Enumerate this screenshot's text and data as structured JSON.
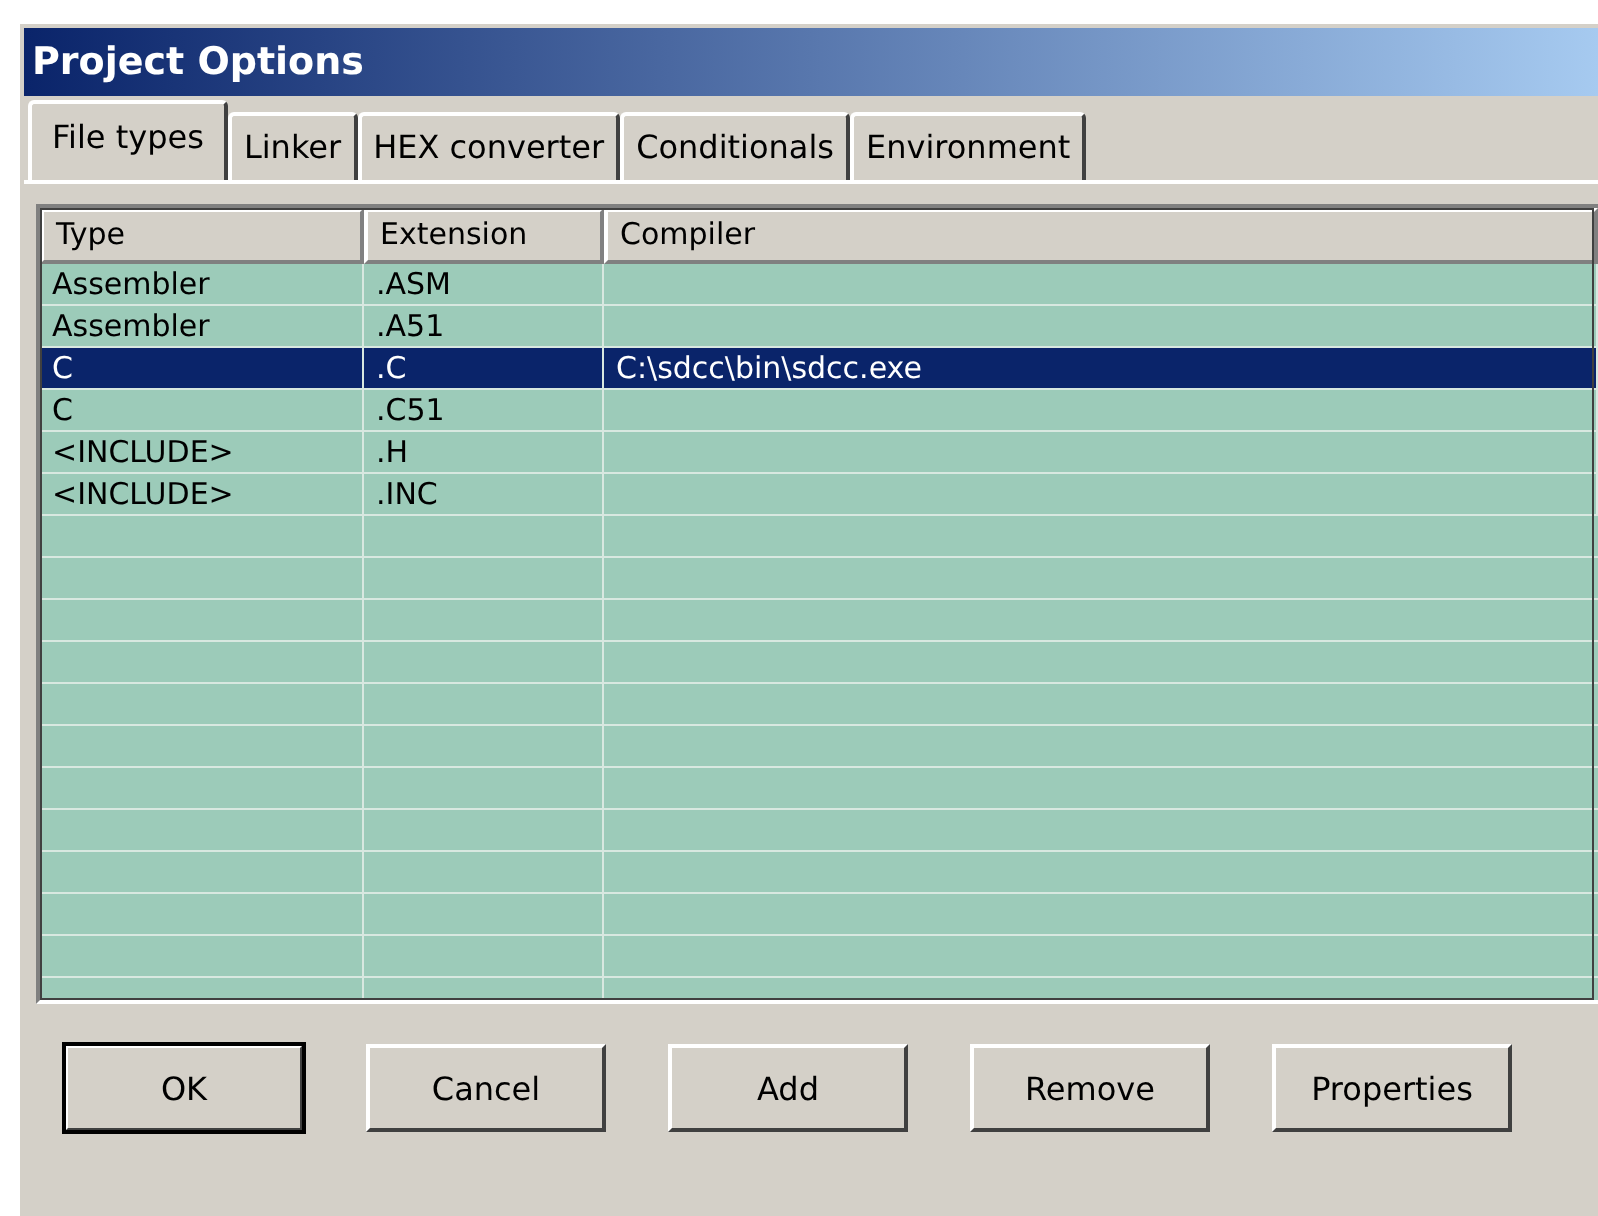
{
  "window": {
    "title": "Project Options"
  },
  "tabs": [
    {
      "label": "File types",
      "selected": true
    },
    {
      "label": "Linker",
      "selected": false
    },
    {
      "label": "HEX converter",
      "selected": false
    },
    {
      "label": "Conditionals",
      "selected": false
    },
    {
      "label": "Environment",
      "selected": false
    }
  ],
  "table": {
    "columns": [
      "Type",
      "Extension",
      "Compiler"
    ],
    "rows": [
      {
        "cells": [
          "Assembler",
          ".ASM",
          ""
        ],
        "selected": false
      },
      {
        "cells": [
          "Assembler",
          ".A51",
          ""
        ],
        "selected": false
      },
      {
        "cells": [
          "C",
          ".C",
          "C:\\sdcc\\bin\\sdcc.exe"
        ],
        "selected": true
      },
      {
        "cells": [
          "C",
          ".C51",
          ""
        ],
        "selected": false
      },
      {
        "cells": [
          "<INCLUDE>",
          ".H",
          ""
        ],
        "selected": false
      },
      {
        "cells": [
          "<INCLUDE>",
          ".INC",
          ""
        ],
        "selected": false
      }
    ]
  },
  "buttons": [
    {
      "label": "OK",
      "default": true
    },
    {
      "label": "Cancel",
      "default": false
    },
    {
      "label": "Add",
      "default": false
    },
    {
      "label": "Remove",
      "default": false
    },
    {
      "label": "Properties",
      "default": false
    }
  ]
}
